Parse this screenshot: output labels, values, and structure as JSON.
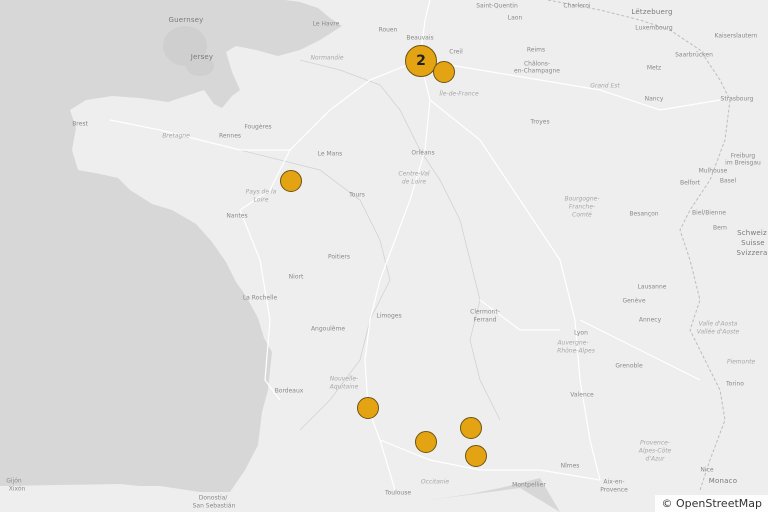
{
  "map": {
    "attribution": "© OpenStreetMap",
    "colors": {
      "sea": "#d6d6d6",
      "land": "#eeeeee",
      "roads": "#ffffff",
      "borders": "#c9c9c9",
      "marker_fill": "#e3a313",
      "marker_stroke": "#6b5410"
    },
    "labels": {
      "guernsey": "Guernsey",
      "jersey": "Jersey",
      "le_havre": "Le Havre",
      "rouen": "Rouen",
      "saint_quentin": "Saint-Quentin",
      "charleroi": "Charleroi",
      "luxembourg_country": "Lëtzebuerg",
      "luxembourg": "Luxembourg",
      "laon": "Laon",
      "reims": "Reims",
      "beauvais": "Beauvais",
      "creil": "Creil",
      "metz": "Metz",
      "normandie": "Normandie",
      "chalons": "Châlons-",
      "en_champagne": "en-Champagne",
      "kaiserslautern": "Kaiserslautern",
      "saarbrucken": "Saarbrücken",
      "ile_de_france": "Île-de-France",
      "grand_est": "Grand Est",
      "nancy": "Nancy",
      "strasbourg": "Strasbourg",
      "brest": "Brest",
      "bretagne": "Bretagne",
      "rennes": "Rennes",
      "fougeres": "Fougères",
      "troyes": "Troyes",
      "le_mans": "Le Mans",
      "orleans": "Orléans",
      "mulhouse": "Mulhouse",
      "freiburg": "Freiburg",
      "im_breisgau": "im Breisgau",
      "centre": "Centre-Val",
      "de_loire": "de Loire",
      "belfort": "Belfort",
      "basel": "Basel",
      "pays": "Pays de la",
      "loire": "Loire",
      "tours": "Tours",
      "bourgogne": "Bourgogne-",
      "franche": "Franche-",
      "comte": "Comté",
      "besancon": "Besançon",
      "biel": "Biel/Bienne",
      "nantes": "Nantes",
      "bern": "Bern",
      "schweiz": "Schweiz",
      "suisse": "Suisse",
      "svizzera": "Svizzera",
      "lausanne": "Lausanne",
      "poitiers": "Poitiers",
      "niort": "Niort",
      "la_rochelle": "La Rochelle",
      "geneve": "Genève",
      "clermont": "Clermont-",
      "ferrand": "Ferrand",
      "limoges": "Limoges",
      "angouleme": "Angoulême",
      "annecy": "Annecy",
      "lyon": "Lyon",
      "auvergne": "Auvergne-",
      "rhone": "Rhône-Alpes",
      "valle": "Valle d'Aosta",
      "vallee": "Vallée d'Aoste",
      "grenoble": "Grenoble",
      "piemonte": "Piemonte",
      "bordeaux": "Bordeaux",
      "nouvelle": "Nouvelle-",
      "aquitaine": "Aquitaine",
      "valence": "Valence",
      "torino": "Torino",
      "provence": "Provence-",
      "alpes": "Alpes-Côte",
      "dazur": "d'Azur",
      "nimes": "Nîmes",
      "montpellier": "Montpellier",
      "aix": "Aix-en-",
      "aix2": "Provence",
      "nice": "Nice",
      "monaco": "Monaco",
      "occitanie": "Occitanie",
      "toulouse": "Toulouse",
      "gijon": "Gijón",
      "xixon": "Xixón",
      "donostia": "Donostia/",
      "san_sebastian": "San Sebastián"
    },
    "markers": [
      {
        "name": "cluster",
        "count": "2"
      },
      {
        "name": "paris-east",
        "count": ""
      },
      {
        "name": "angers",
        "count": ""
      },
      {
        "name": "agen",
        "count": ""
      },
      {
        "name": "albi",
        "count": ""
      },
      {
        "name": "rodez",
        "count": ""
      },
      {
        "name": "millau",
        "count": ""
      }
    ]
  }
}
